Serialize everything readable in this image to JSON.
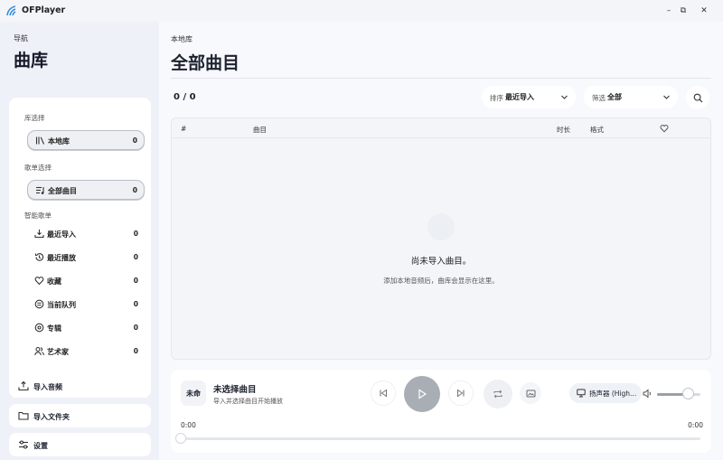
{
  "app": {
    "title": "OFPlayer"
  },
  "window": {
    "minimize": "–",
    "maximize": "⧉",
    "close": "✕"
  },
  "sidebar": {
    "nav_small": "导航",
    "nav_title": "曲库",
    "library_section": "库选择",
    "library_item": {
      "label": "本地库",
      "count": "0"
    },
    "playlist_section": "歌单选择",
    "playlist_item": {
      "label": "全部曲目",
      "count": "0"
    },
    "smart_section": "智能歌单",
    "smart_items": [
      {
        "label": "最近导入",
        "count": "0",
        "icon": "import-tray-icon"
      },
      {
        "label": "最近播放",
        "count": "0",
        "icon": "history-icon"
      },
      {
        "label": "收藏",
        "count": "0",
        "icon": "heart-icon"
      },
      {
        "label": "当前队列",
        "count": "0",
        "icon": "queue-icon"
      },
      {
        "label": "专辑",
        "count": "0",
        "icon": "album-disc-icon"
      },
      {
        "label": "艺术家",
        "count": "0",
        "icon": "artist-people-icon"
      }
    ],
    "actions": {
      "import_audio": "导入音频",
      "import_folder": "导入文件夹",
      "settings": "设置"
    }
  },
  "main": {
    "breadcrumb": "本地库",
    "title": "全部曲目",
    "count": "0 / 0",
    "sort": {
      "label": "排序",
      "value": "最近导入"
    },
    "filter": {
      "label": "筛选",
      "value": "全部"
    },
    "table": {
      "columns": [
        "#",
        "曲目",
        "时长",
        "格式"
      ],
      "empty_title": "尚未导入曲目。",
      "empty_sub": "添加本地音频后，曲库会显示在这里。"
    }
  },
  "player": {
    "cover_text": "未命",
    "track_title": "未选择曲目",
    "track_sub": "导入并选择曲目开始播放",
    "device": "扬声器 (High...",
    "volume": 0.72,
    "time_current": "0:00",
    "time_total": "0:00",
    "progress": 0
  },
  "colors": {
    "accent": "#3a8dde",
    "play_disabled": "#a9adb4"
  }
}
